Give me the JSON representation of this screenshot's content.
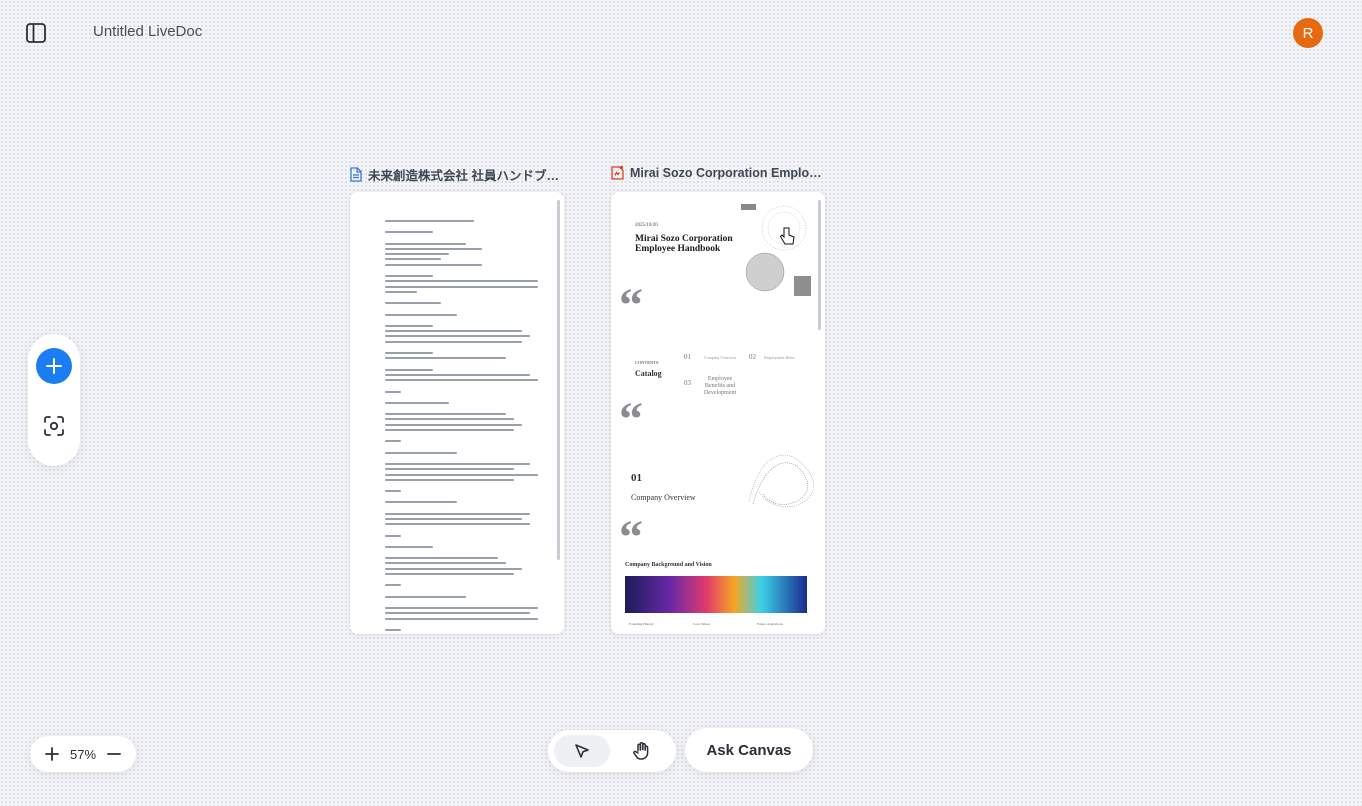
{
  "header": {
    "title": "Untitled LiveDoc",
    "avatar_initial": "R",
    "avatar_color": "#e86a10"
  },
  "left_toolbar": {
    "add_icon": "plus-icon",
    "focus_icon": "focus-scan-icon",
    "accent": "#1a7ef2"
  },
  "documents": [
    {
      "name": "未来創造株式会社 社員ハンドブッ...",
      "icon": "document-icon",
      "icon_color": "#3a7bd5"
    },
    {
      "name": "Mirai Sozo Corporation Employee...",
      "icon": "pdf-document-icon",
      "icon_color": "#d9412a",
      "preview": {
        "date": "2025/10/20",
        "title_line1": "Mirai Sozo Corporation",
        "title_line2": "Employee Handbook",
        "contents_label": "CONTENTS",
        "catalog_label": "Catalog",
        "toc": [
          {
            "num": "01",
            "label": "Company Overview"
          },
          {
            "num": "02",
            "label": "Employment Rules"
          },
          {
            "num": "03",
            "label": "Employee Benefits and Development"
          }
        ],
        "section_num": "01",
        "section_title": "Company Overview",
        "banner_title": "Company Background and Vision",
        "footer_items": [
          "Founding History",
          "Core Values",
          "Future Aspirations"
        ]
      }
    }
  ],
  "zoom": {
    "value": "57%"
  },
  "tools": {
    "select_icon": "cursor-arrow-icon",
    "pan_icon": "hand-icon",
    "ask_label": "Ask Canvas"
  }
}
